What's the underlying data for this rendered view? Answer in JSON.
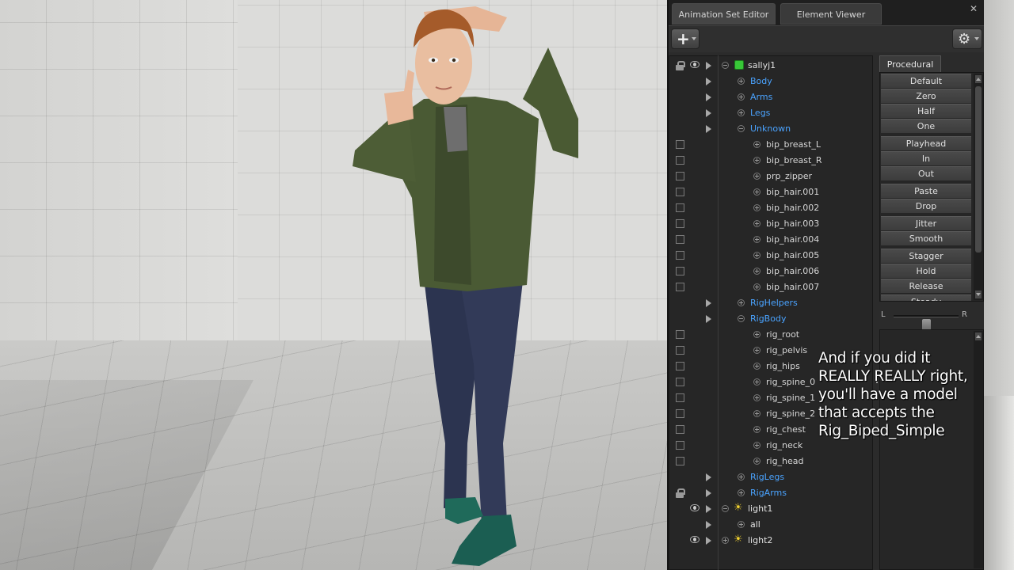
{
  "tabs": [
    {
      "label": "Animation Set Editor",
      "active": true
    },
    {
      "label": "Element Viewer",
      "active": false
    }
  ],
  "toolbar": {
    "add_icon": "plus-icon",
    "settings_icon": "gear-icon"
  },
  "tree": [
    {
      "label": "sallyj1",
      "style": "white",
      "icon": "cube-icon",
      "lock": true,
      "eye": true,
      "play": true,
      "expander": "minus",
      "level": 0
    },
    {
      "label": "Body",
      "style": "blue",
      "play": true,
      "expander": "plus",
      "level": 1
    },
    {
      "label": "Arms",
      "style": "blue",
      "play": true,
      "expander": "plus",
      "level": 1
    },
    {
      "label": "Legs",
      "style": "blue",
      "play": true,
      "expander": "plus",
      "level": 1
    },
    {
      "label": "Unknown",
      "style": "blue",
      "play": true,
      "expander": "minus",
      "level": 1
    },
    {
      "label": "bip_breast_L",
      "style": "bone",
      "checkbox": true,
      "expander": "plus",
      "level": 2
    },
    {
      "label": "bip_breast_R",
      "style": "bone",
      "checkbox": true,
      "expander": "plus",
      "level": 2
    },
    {
      "label": "prp_zipper",
      "style": "bone",
      "checkbox": true,
      "expander": "plus",
      "level": 2
    },
    {
      "label": "bip_hair.001",
      "style": "bone",
      "checkbox": true,
      "expander": "plus",
      "level": 2
    },
    {
      "label": "bip_hair.002",
      "style": "bone",
      "checkbox": true,
      "expander": "plus",
      "level": 2
    },
    {
      "label": "bip_hair.003",
      "style": "bone",
      "checkbox": true,
      "expander": "plus",
      "level": 2
    },
    {
      "label": "bip_hair.004",
      "style": "bone",
      "checkbox": true,
      "expander": "plus",
      "level": 2
    },
    {
      "label": "bip_hair.005",
      "style": "bone",
      "checkbox": true,
      "expander": "plus",
      "level": 2
    },
    {
      "label": "bip_hair.006",
      "style": "bone",
      "checkbox": true,
      "expander": "plus",
      "level": 2
    },
    {
      "label": "bip_hair.007",
      "style": "bone",
      "checkbox": true,
      "expander": "plus",
      "level": 2
    },
    {
      "label": "RigHelpers",
      "style": "blue",
      "play": true,
      "expander": "plus",
      "level": 1
    },
    {
      "label": "RigBody",
      "style": "blue",
      "play": true,
      "expander": "minus",
      "level": 1
    },
    {
      "label": "rig_root",
      "style": "bone",
      "checkbox": true,
      "expander": "plus",
      "level": 2
    },
    {
      "label": "rig_pelvis",
      "style": "bone",
      "checkbox": true,
      "expander": "plus",
      "level": 2
    },
    {
      "label": "rig_hips",
      "style": "bone",
      "checkbox": true,
      "expander": "plus",
      "level": 2
    },
    {
      "label": "rig_spine_0",
      "style": "bone",
      "checkbox": true,
      "expander": "plus",
      "level": 2
    },
    {
      "label": "rig_spine_1",
      "style": "bone",
      "checkbox": true,
      "expander": "plus",
      "level": 2
    },
    {
      "label": "rig_spine_2",
      "style": "bone",
      "checkbox": true,
      "expander": "plus",
      "level": 2
    },
    {
      "label": "rig_chest",
      "style": "bone",
      "checkbox": true,
      "expander": "plus",
      "level": 2
    },
    {
      "label": "rig_neck",
      "style": "bone",
      "checkbox": true,
      "expander": "plus",
      "level": 2
    },
    {
      "label": "rig_head",
      "style": "bone",
      "checkbox": true,
      "expander": "plus",
      "level": 2
    },
    {
      "label": "RigLegs",
      "style": "blue",
      "play": true,
      "expander": "plus",
      "level": 1
    },
    {
      "label": "RigArms",
      "style": "blue",
      "lock": true,
      "play": true,
      "expander": "plus",
      "level": 1
    },
    {
      "label": "light1",
      "style": "white",
      "icon": "light-icon",
      "eye": true,
      "play": true,
      "expander": "minus",
      "level": 0
    },
    {
      "label": "all",
      "style": "white",
      "play": true,
      "expander": "plus",
      "level": 1
    },
    {
      "label": "light2",
      "style": "white",
      "icon": "light-icon",
      "eye": true,
      "play": true,
      "expander": "plus",
      "level": 0
    }
  ],
  "procedural": {
    "tab_label": "Procedural",
    "buttons": [
      "Default",
      "Zero",
      "Half",
      "One",
      "Playhead",
      "In",
      "Out",
      "Paste",
      "Drop",
      "Jitter",
      "Smooth",
      "Stagger",
      "Hold",
      "Release",
      "Steady"
    ],
    "slider_left": "L",
    "slider_right": "R",
    "balance": 0.5
  },
  "caption": "And if you did it REALLY REALLY right, you'll have a model that accepts the Rig_Biped_Simple",
  "colors": {
    "group_label": "#4aa3ff",
    "cube_icon": "#38c838",
    "light_icon": "#f0d030",
    "panel_bg": "#2b2b2b"
  }
}
